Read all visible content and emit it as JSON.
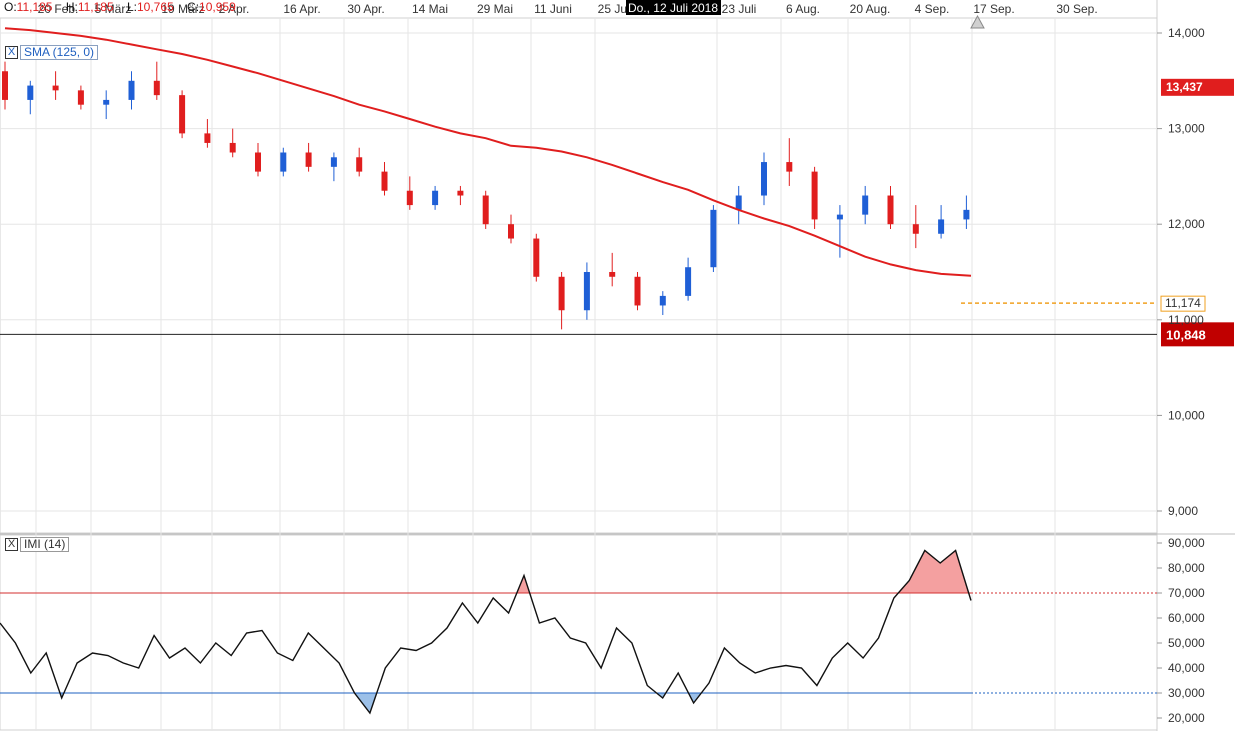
{
  "header": {
    "open_label": "O:",
    "open_value": "11,185",
    "high_label": "H:",
    "high_value": "11,185",
    "low_label": "L:",
    "low_value": "10,765",
    "close_label": "C:",
    "close_value": "10,959",
    "crosshair_date": "Do., 12 Juli 2018"
  },
  "indicators": {
    "sma": {
      "close_symbol": "X",
      "label": "SMA (125, 0)"
    },
    "imi": {
      "close_symbol": "X",
      "label": "IMI (14)"
    }
  },
  "colors": {
    "up": "#1f5fd6",
    "down": "#e01e1e",
    "sma": "#e01e1e",
    "current_price_label": "#c00000",
    "last_price_label": "#e01e1e",
    "alert_line": "#f0a020",
    "grid": "#e6e6e6",
    "imi_upper": "#d32f2f",
    "imi_lower": "#1e60c0",
    "imi_fill_upper": "#f4a0a0",
    "imi_fill_lower": "#9cc0e8"
  },
  "icons": {
    "scroll_marker": "triangle-up-icon"
  },
  "chart_data": [
    {
      "type": "candlestick",
      "x_tick_labels": [
        "20 Feb.",
        "5 März",
        "19 März",
        "2 Apr.",
        "16 Apr.",
        "30 Apr.",
        "14 Mai",
        "29 Mai",
        "11 Juni",
        "25 Juni",
        "23 Juli",
        "6 Aug.",
        "20 Aug.",
        "4 Sep.",
        "17 Sep.",
        "30 Sep."
      ],
      "y_tick_labels": [
        "14,000",
        "13,000",
        "12,000",
        "11,000",
        "10,000",
        "9,000"
      ],
      "ylim": [
        8.8,
        14.3
      ],
      "price_labels": {
        "last": "13,437",
        "alert": "11,174",
        "current": "10,848"
      },
      "levels": {
        "last": 13.437,
        "alert": 11.174,
        "current": 10.848
      },
      "series": [
        {
          "name": "SMA (125, 0)",
          "values": [
            14.05,
            14.03,
            14.0,
            13.97,
            13.93,
            13.88,
            13.83,
            13.78,
            13.72,
            13.65,
            13.58,
            13.5,
            13.42,
            13.34,
            13.25,
            13.18,
            13.1,
            13.02,
            12.95,
            12.9,
            12.82,
            12.8,
            12.76,
            12.7,
            12.62,
            12.53,
            12.44,
            12.36,
            12.25,
            12.15,
            12.06,
            11.98,
            11.88,
            11.77,
            11.66,
            11.58,
            11.52,
            11.48,
            11.46
          ]
        }
      ],
      "ohlc": [
        [
          13.6,
          13.7,
          13.2,
          13.3
        ],
        [
          13.3,
          13.5,
          13.15,
          13.45
        ],
        [
          13.45,
          13.6,
          13.3,
          13.4
        ],
        [
          13.4,
          13.45,
          13.2,
          13.25
        ],
        [
          13.25,
          13.4,
          13.1,
          13.3
        ],
        [
          13.3,
          13.6,
          13.2,
          13.5
        ],
        [
          13.5,
          13.7,
          13.3,
          13.35
        ],
        [
          13.35,
          13.4,
          12.9,
          12.95
        ],
        [
          12.95,
          13.1,
          12.8,
          12.85
        ],
        [
          12.85,
          13.0,
          12.7,
          12.75
        ],
        [
          12.75,
          12.85,
          12.5,
          12.55
        ],
        [
          12.55,
          12.8,
          12.5,
          12.75
        ],
        [
          12.75,
          12.85,
          12.55,
          12.6
        ],
        [
          12.6,
          12.75,
          12.45,
          12.7
        ],
        [
          12.7,
          12.8,
          12.5,
          12.55
        ],
        [
          12.55,
          12.65,
          12.3,
          12.35
        ],
        [
          12.35,
          12.5,
          12.15,
          12.2
        ],
        [
          12.2,
          12.4,
          12.15,
          12.35
        ],
        [
          12.35,
          12.4,
          12.2,
          12.3
        ],
        [
          12.3,
          12.35,
          11.95,
          12.0
        ],
        [
          12.0,
          12.1,
          11.8,
          11.85
        ],
        [
          11.85,
          11.9,
          11.4,
          11.45
        ],
        [
          11.45,
          11.5,
          10.9,
          11.1
        ],
        [
          11.1,
          11.6,
          11.0,
          11.5
        ],
        [
          11.5,
          11.7,
          11.35,
          11.45
        ],
        [
          11.45,
          11.5,
          11.1,
          11.15
        ],
        [
          11.15,
          11.3,
          11.05,
          11.25
        ],
        [
          11.25,
          11.65,
          11.2,
          11.55
        ],
        [
          11.55,
          12.2,
          11.5,
          12.15
        ],
        [
          12.15,
          12.4,
          12.0,
          12.3
        ],
        [
          12.3,
          12.75,
          12.2,
          12.65
        ],
        [
          12.65,
          12.9,
          12.4,
          12.55
        ],
        [
          12.55,
          12.6,
          11.95,
          12.05
        ],
        [
          12.05,
          12.2,
          11.65,
          12.1
        ],
        [
          12.1,
          12.4,
          12.0,
          12.3
        ],
        [
          12.3,
          12.4,
          11.95,
          12.0
        ],
        [
          12.0,
          12.2,
          11.75,
          11.9
        ],
        [
          11.9,
          12.2,
          11.85,
          12.05
        ],
        [
          12.05,
          12.3,
          11.95,
          12.15
        ]
      ]
    },
    {
      "type": "line",
      "y_tick_labels": [
        "90,000",
        "80,000",
        "70,000",
        "60,000",
        "50,000",
        "40,000",
        "30,000",
        "20,000"
      ],
      "ylim": [
        19,
        91
      ],
      "thresholds": {
        "upper": 70,
        "lower": 30
      },
      "series": [
        {
          "name": "IMI (14)",
          "values": [
            58,
            50,
            38,
            46,
            28,
            42,
            46,
            45,
            42,
            40,
            53,
            44,
            48,
            42,
            50,
            45,
            54,
            55,
            46,
            43,
            54,
            48,
            42,
            30,
            22,
            40,
            48,
            47,
            50,
            56,
            66,
            58,
            68,
            62,
            77,
            58,
            60,
            52,
            50,
            40,
            56,
            50,
            33,
            28,
            38,
            26,
            34,
            48,
            42,
            38,
            40,
            41,
            40,
            33,
            44,
            50,
            44,
            52,
            68,
            75,
            87,
            82,
            87,
            67
          ]
        }
      ]
    }
  ]
}
